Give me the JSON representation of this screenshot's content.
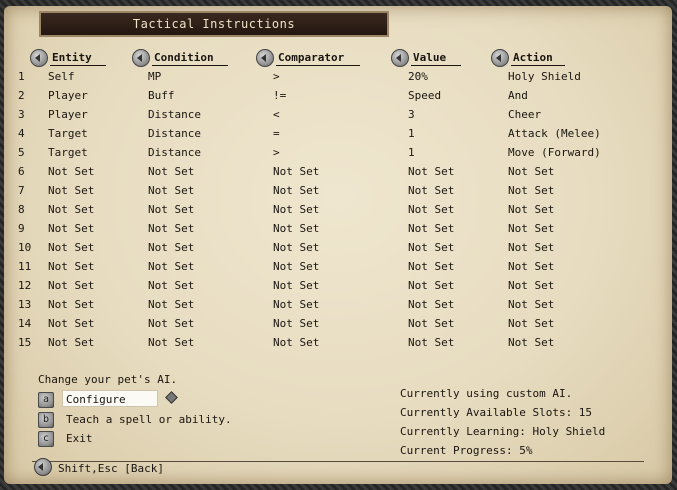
{
  "title": "Tactical Instructions",
  "columns": [
    "Entity",
    "Condition",
    "Comparator",
    "Value",
    "Action"
  ],
  "rows": [
    [
      "1",
      "Self",
      "MP",
      ">",
      "20%",
      "Holy Shield"
    ],
    [
      "2",
      "Player",
      "Buff",
      "!=",
      "Speed",
      "And"
    ],
    [
      "3",
      "Player",
      "Distance",
      "<",
      "3",
      "Cheer"
    ],
    [
      "4",
      "Target",
      "Distance",
      "=",
      "1",
      "Attack (Melee)"
    ],
    [
      "5",
      "Target",
      "Distance",
      ">",
      "1",
      "Move (Forward)"
    ],
    [
      "6",
      "Not Set",
      "Not Set",
      "Not Set",
      "Not Set",
      "Not Set"
    ],
    [
      "7",
      "Not Set",
      "Not Set",
      "Not Set",
      "Not Set",
      "Not Set"
    ],
    [
      "8",
      "Not Set",
      "Not Set",
      "Not Set",
      "Not Set",
      "Not Set"
    ],
    [
      "9",
      "Not Set",
      "Not Set",
      "Not Set",
      "Not Set",
      "Not Set"
    ],
    [
      "10",
      "Not Set",
      "Not Set",
      "Not Set",
      "Not Set",
      "Not Set"
    ],
    [
      "11",
      "Not Set",
      "Not Set",
      "Not Set",
      "Not Set",
      "Not Set"
    ],
    [
      "12",
      "Not Set",
      "Not Set",
      "Not Set",
      "Not Set",
      "Not Set"
    ],
    [
      "13",
      "Not Set",
      "Not Set",
      "Not Set",
      "Not Set",
      "Not Set"
    ],
    [
      "14",
      "Not Set",
      "Not Set",
      "Not Set",
      "Not Set",
      "Not Set"
    ],
    [
      "15",
      "Not Set",
      "Not Set",
      "Not Set",
      "Not Set",
      "Not Set"
    ]
  ],
  "message": "Change your pet's AI.",
  "options": [
    {
      "key": "a",
      "label": "Configure"
    },
    {
      "key": "b",
      "label": "Teach a spell or ability."
    },
    {
      "key": "c",
      "label": "Exit"
    }
  ],
  "status": [
    "Currently using custom AI.",
    "Currently Available Slots: 15",
    "Currently Learning: Holy Shield",
    "Current Progress: 5%"
  ],
  "footer": "Shift,Esc [Back]"
}
